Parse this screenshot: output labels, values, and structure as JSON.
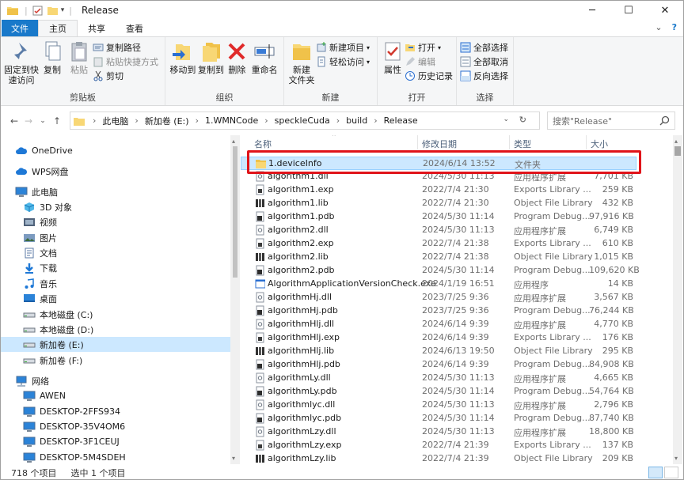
{
  "window": {
    "title": "Release",
    "minimize": "─",
    "maximize": "☐",
    "close": "✕"
  },
  "ribbon_tabs": {
    "file": "文件",
    "home": "主页",
    "share": "共享",
    "view": "查看"
  },
  "ribbon": {
    "clipboard": {
      "pin": "固定到快\n速访问",
      "pin_l1": "固定到快",
      "pin_l2": "速访问",
      "copy": "复制",
      "paste": "粘贴",
      "copy_path": "复制路径",
      "paste_shortcut": "粘贴快捷方式",
      "cut": "剪切",
      "label": "剪贴板"
    },
    "organize": {
      "move_to": "移动到",
      "copy_to": "复制到",
      "delete": "删除",
      "rename": "重命名",
      "label": "组织"
    },
    "new": {
      "new_folder_l1": "新建",
      "new_folder_l2": "文件夹",
      "new_item": "新建项目",
      "easy_access": "轻松访问",
      "label": "新建"
    },
    "open": {
      "properties": "属性",
      "open": "打开",
      "edit": "编辑",
      "history": "历史记录",
      "label": "打开"
    },
    "select": {
      "select_all": "全部选择",
      "select_none": "全部取消",
      "invert": "反向选择",
      "label": "选择"
    }
  },
  "address": {
    "crumbs": [
      "此电脑",
      "新加卷 (E:)",
      "1.WMNCode",
      "speckleCuda",
      "build",
      "Release"
    ],
    "search_placeholder": "搜索\"Release\""
  },
  "sidebar": {
    "items": [
      {
        "label": "OneDrive",
        "icon": "cloud-icon"
      },
      {
        "label": "WPS网盘",
        "icon": "cloud-icon"
      },
      {
        "label": "此电脑",
        "icon": "computer-icon"
      },
      {
        "label": "3D 对象",
        "icon": "cube-icon"
      },
      {
        "label": "视频",
        "icon": "video-icon"
      },
      {
        "label": "图片",
        "icon": "picture-icon"
      },
      {
        "label": "文档",
        "icon": "document-icon"
      },
      {
        "label": "下载",
        "icon": "download-icon"
      },
      {
        "label": "音乐",
        "icon": "music-icon"
      },
      {
        "label": "桌面",
        "icon": "desktop-icon"
      },
      {
        "label": "本地磁盘 (C:)",
        "icon": "drive-icon"
      },
      {
        "label": "本地磁盘 (D:)",
        "icon": "drive-icon"
      },
      {
        "label": "新加卷 (E:)",
        "icon": "drive-icon"
      },
      {
        "label": "新加卷 (F:)",
        "icon": "drive-icon"
      },
      {
        "label": "网络",
        "icon": "network-icon"
      },
      {
        "label": "AWEN",
        "icon": "computer-icon"
      },
      {
        "label": "DESKTOP-2FFS934",
        "icon": "computer-icon"
      },
      {
        "label": "DESKTOP-35V4OM6",
        "icon": "computer-icon"
      },
      {
        "label": "DESKTOP-3F1CEUJ",
        "icon": "computer-icon"
      },
      {
        "label": "DESKTOP-5M4SDEH",
        "icon": "computer-icon"
      }
    ]
  },
  "columns": {
    "name": "名称",
    "date": "修改日期",
    "type": "类型",
    "size": "大小"
  },
  "files": [
    {
      "name": "1.deviceInfo",
      "date": "2024/6/14 13:52",
      "type": "文件夹",
      "size": "",
      "icon": "folder"
    },
    {
      "name": "algorithm1.dll",
      "date": "2024/5/30 11:13",
      "type": "应用程序扩展",
      "size": "7,701 KB",
      "icon": "dll"
    },
    {
      "name": "algorithm1.exp",
      "date": "2022/7/4 21:30",
      "type": "Exports Library ...",
      "size": "259 KB",
      "icon": "exp"
    },
    {
      "name": "algorithm1.lib",
      "date": "2022/7/4 21:30",
      "type": "Object File Library",
      "size": "432 KB",
      "icon": "lib"
    },
    {
      "name": "algorithm1.pdb",
      "date": "2024/5/30 11:14",
      "type": "Program Debug...",
      "size": "97,916 KB",
      "icon": "pdb"
    },
    {
      "name": "algorithm2.dll",
      "date": "2024/5/30 11:13",
      "type": "应用程序扩展",
      "size": "6,749 KB",
      "icon": "dll"
    },
    {
      "name": "algorithm2.exp",
      "date": "2022/7/4 21:38",
      "type": "Exports Library ...",
      "size": "610 KB",
      "icon": "exp"
    },
    {
      "name": "algorithm2.lib",
      "date": "2022/7/4 21:38",
      "type": "Object File Library",
      "size": "1,015 KB",
      "icon": "lib"
    },
    {
      "name": "algorithm2.pdb",
      "date": "2024/5/30 11:14",
      "type": "Program Debug...",
      "size": "109,620 KB",
      "icon": "pdb"
    },
    {
      "name": "AlgorithmApplicationVersionCheck.exe",
      "date": "2024/1/19 16:51",
      "type": "应用程序",
      "size": "14 KB",
      "icon": "exe"
    },
    {
      "name": "algorithmHj.dll",
      "date": "2023/7/25 9:36",
      "type": "应用程序扩展",
      "size": "3,567 KB",
      "icon": "dll"
    },
    {
      "name": "algorithmHj.pdb",
      "date": "2023/7/25 9:36",
      "type": "Program Debug...",
      "size": "76,244 KB",
      "icon": "pdb"
    },
    {
      "name": "algorithmHlj.dll",
      "date": "2024/6/14 9:39",
      "type": "应用程序扩展",
      "size": "4,770 KB",
      "icon": "dll"
    },
    {
      "name": "algorithmHlj.exp",
      "date": "2024/6/14 9:39",
      "type": "Exports Library ...",
      "size": "176 KB",
      "icon": "exp"
    },
    {
      "name": "algorithmHlj.lib",
      "date": "2024/6/13 19:50",
      "type": "Object File Library",
      "size": "295 KB",
      "icon": "lib"
    },
    {
      "name": "algorithmHlj.pdb",
      "date": "2024/6/14 9:39",
      "type": "Program Debug...",
      "size": "84,908 KB",
      "icon": "pdb"
    },
    {
      "name": "algorithmLy.dll",
      "date": "2024/5/30 11:13",
      "type": "应用程序扩展",
      "size": "4,665 KB",
      "icon": "dll"
    },
    {
      "name": "algorithmLy.pdb",
      "date": "2024/5/30 11:14",
      "type": "Program Debug...",
      "size": "54,764 KB",
      "icon": "pdb"
    },
    {
      "name": "algorithmlyc.dll",
      "date": "2024/5/30 11:13",
      "type": "应用程序扩展",
      "size": "2,796 KB",
      "icon": "dll"
    },
    {
      "name": "algorithmlyc.pdb",
      "date": "2024/5/30 11:14",
      "type": "Program Debug...",
      "size": "87,740 KB",
      "icon": "pdb"
    },
    {
      "name": "algorithmLzy.dll",
      "date": "2024/5/30 11:13",
      "type": "应用程序扩展",
      "size": "18,800 KB",
      "icon": "dll"
    },
    {
      "name": "algorithmLzy.exp",
      "date": "2022/7/4 21:39",
      "type": "Exports Library ...",
      "size": "137 KB",
      "icon": "exp"
    },
    {
      "name": "algorithmLzy.lib",
      "date": "2022/7/4 21:39",
      "type": "Object File Library",
      "size": "209 KB",
      "icon": "lib"
    }
  ],
  "status": {
    "count": "718 个项目",
    "selected": "选中 1 个项目"
  },
  "colors": {
    "accent": "#1979ca",
    "selection": "#cce8ff",
    "highlight_box": "#e0141a",
    "folder": "#f8d775"
  }
}
